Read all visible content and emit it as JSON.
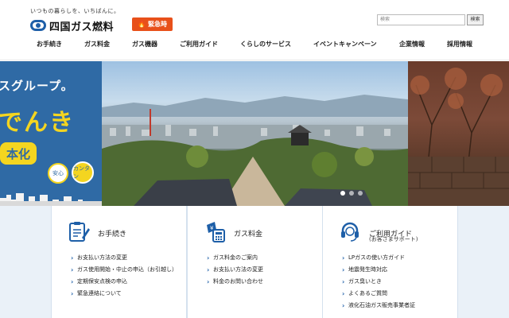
{
  "header": {
    "tagline": "いつもの暮らしを、いちばんに。",
    "logo_text": "四国ガス燃料",
    "emergency_label": "緊急時",
    "search_placeholder": "検索",
    "search_button": "検索"
  },
  "nav": [
    {
      "label": "お手続き"
    },
    {
      "label": "ガス料金"
    },
    {
      "label": "ガス機器"
    },
    {
      "label": "ご利用ガイド"
    },
    {
      "label": "くらしのサービス"
    },
    {
      "label": "イベントキャンペーン"
    },
    {
      "label": "企業情報"
    },
    {
      "label": "採用情報"
    }
  ],
  "hero": {
    "left_text1": "スグループ。",
    "left_text2": "でんき",
    "left_badge": "本化",
    "left_circle1": "安心",
    "left_circle2": "カンタン",
    "slide_count": 3,
    "active_slide": 1
  },
  "cards": [
    {
      "title": "お手続き",
      "subtitle": "",
      "icon": "clipboard-pen-icon",
      "items": [
        "お支払い方法の変更",
        "ガス使用開始・中止の申込（お引越し）",
        "定期保安点検の申込",
        "緊急連絡について"
      ]
    },
    {
      "title": "ガス料金",
      "subtitle": "",
      "icon": "yen-calculator-icon",
      "items": [
        "ガス料金のご案内",
        "お支払い方法の変更",
        "料金のお問い合わせ"
      ]
    },
    {
      "title": "ご利用ガイド",
      "subtitle": "(お客さまサポート)",
      "icon": "headset-support-icon",
      "items": [
        "LPガスの使い方ガイド",
        "地震発生時対応",
        "ガス臭いとき",
        "よくあるご質問",
        "液化石油ガス販売事業者証"
      ]
    }
  ],
  "colors": {
    "brand_blue": "#1e5fa8",
    "emergency_orange": "#e8501a",
    "banner_blue": "#2f6aa5",
    "banner_yellow": "#f4d520",
    "card_bg": "#eaf1f8"
  }
}
